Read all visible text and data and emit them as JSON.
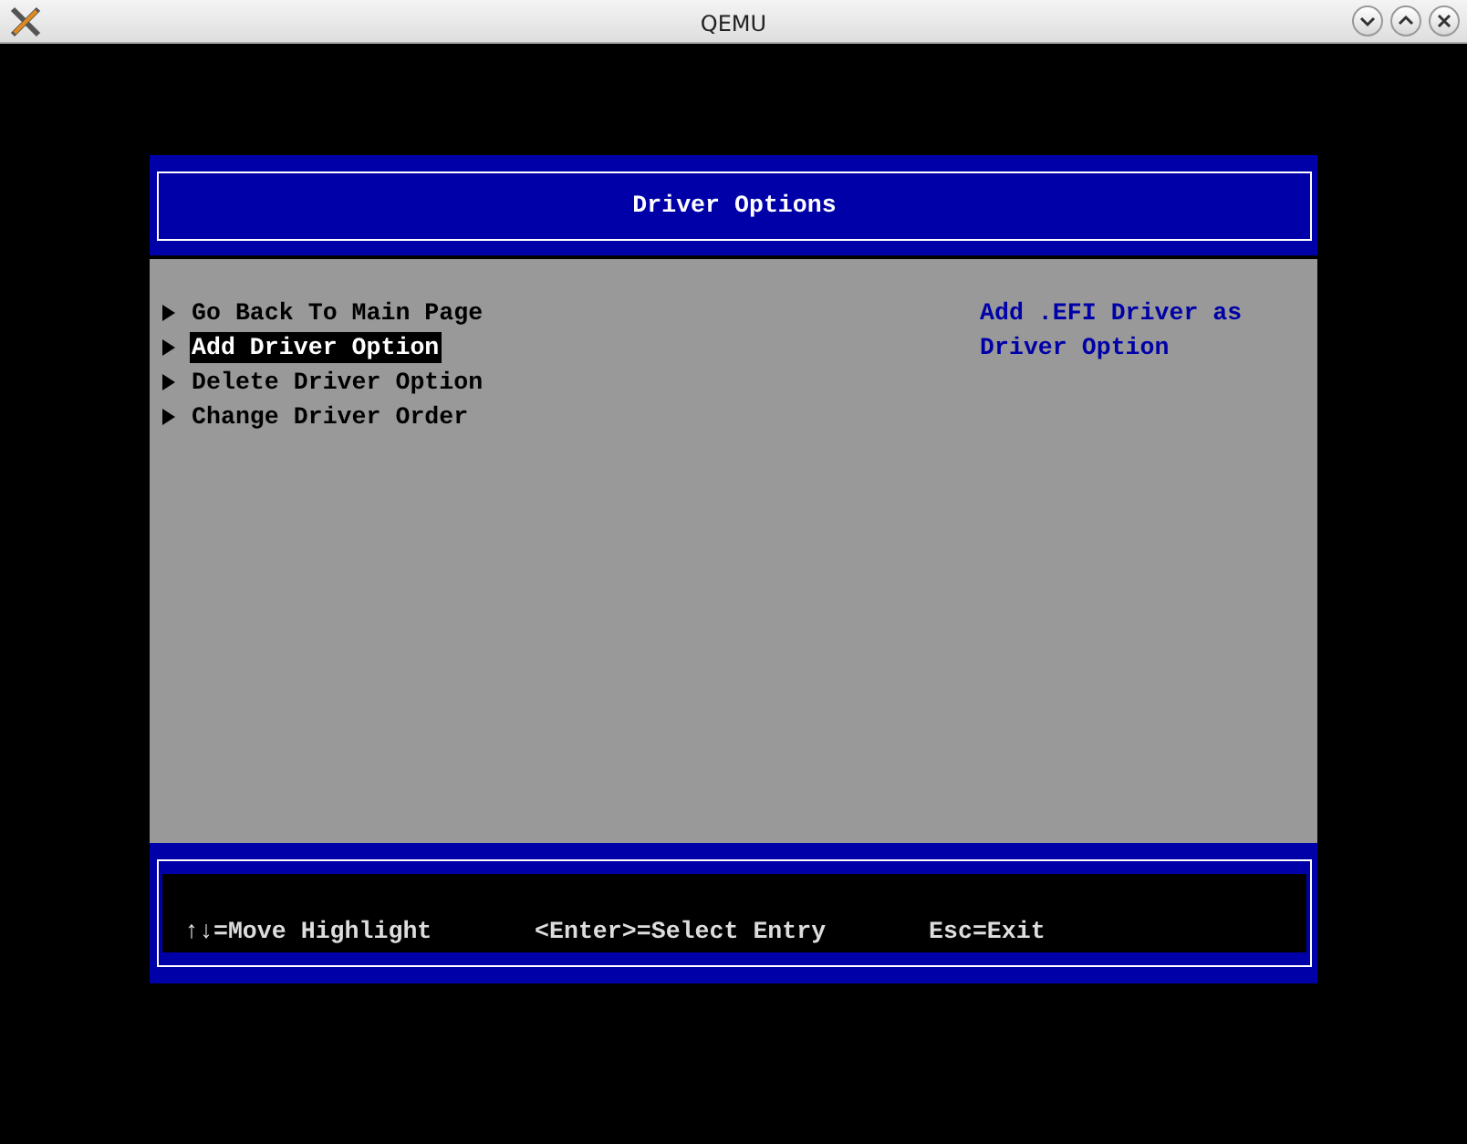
{
  "window": {
    "title": "QEMU"
  },
  "header": {
    "title": "Driver Options"
  },
  "menu": [
    {
      "label": "Go Back To Main Page",
      "selected": false
    },
    {
      "label": "Add Driver Option",
      "selected": true
    },
    {
      "label": "Delete Driver Option",
      "selected": false
    },
    {
      "label": "Change Driver Order",
      "selected": false
    }
  ],
  "help": {
    "text": "Add .EFI Driver as Driver Option"
  },
  "footer": [
    "↑↓=Move Highlight",
    "<Enter>=Select Entry",
    "Esc=Exit"
  ]
}
